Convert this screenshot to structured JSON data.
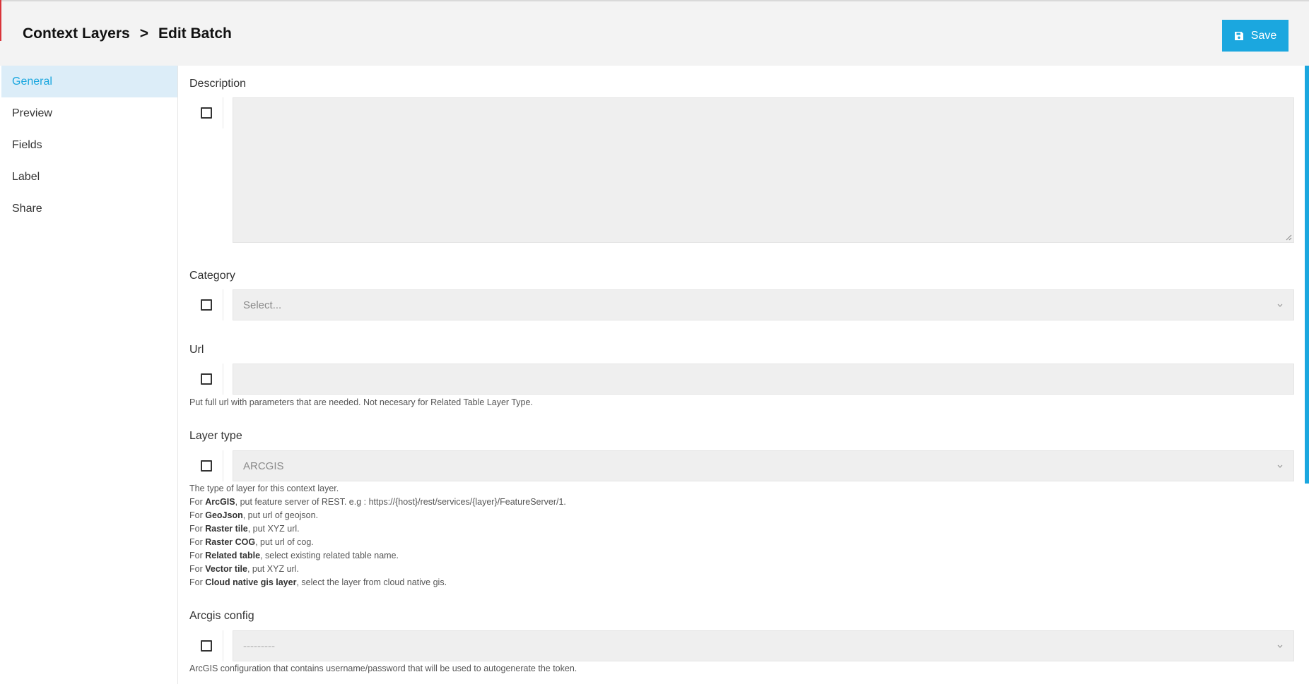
{
  "breadcrumb": {
    "parent": "Context Layers",
    "separator": ">",
    "current": "Edit Batch"
  },
  "header": {
    "save_label": "Save",
    "save_icon": "floppy-disk-icon",
    "accent_color": "#1ba7df"
  },
  "sidebar": {
    "items": [
      {
        "label": "General",
        "active": true
      },
      {
        "label": "Preview",
        "active": false
      },
      {
        "label": "Fields",
        "active": false
      },
      {
        "label": "Label",
        "active": false
      },
      {
        "label": "Share",
        "active": false
      }
    ]
  },
  "form": {
    "description": {
      "label": "Description",
      "value": ""
    },
    "category": {
      "label": "Category",
      "placeholder": "Select..."
    },
    "url": {
      "label": "Url",
      "value": "",
      "help": "Put full url with parameters that are needed. Not necesary for Related Table Layer Type."
    },
    "layer_type": {
      "label": "Layer type",
      "value": "ARCGIS",
      "help": {
        "intro": "The type of layer for this context layer.",
        "lines": [
          {
            "prefix": "For ",
            "bold": "ArcGIS",
            "rest": ", put feature server of REST. e.g : https://{host}/rest/services/{layer}/FeatureServer/1."
          },
          {
            "prefix": "For ",
            "bold": "GeoJson",
            "rest": ", put url of geojson."
          },
          {
            "prefix": "For ",
            "bold": "Raster tile",
            "rest": ", put XYZ url."
          },
          {
            "prefix": "For ",
            "bold": "Raster COG",
            "rest": ", put url of cog."
          },
          {
            "prefix": "For ",
            "bold": "Related table",
            "rest": ", select existing related table name."
          },
          {
            "prefix": "For ",
            "bold": "Vector tile",
            "rest": ", put XYZ url."
          },
          {
            "prefix": "For ",
            "bold": "Cloud native gis layer",
            "rest": ", select the layer from cloud native gis."
          }
        ]
      }
    },
    "arcgis_config": {
      "label": "Arcgis config",
      "value": "---------",
      "help": "ArcGIS configuration that contains username/password that will be used to autogenerate the token."
    }
  }
}
